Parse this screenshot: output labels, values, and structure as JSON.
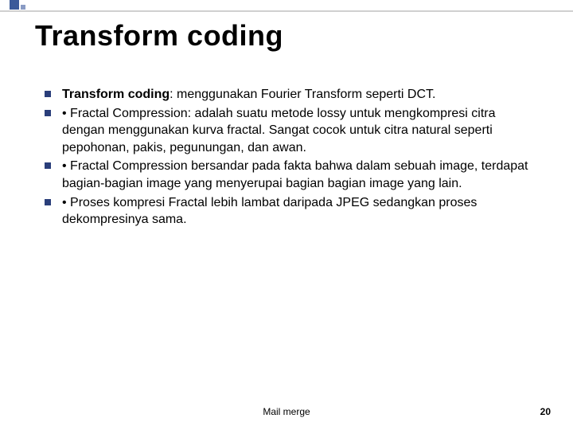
{
  "title": "Transform coding",
  "bullets": [
    {
      "prefix": "Transform coding",
      "text": ": menggunakan Fourier Transform seperti DCT."
    },
    {
      "prefix": "",
      "text": "• Fractal Compression: adalah suatu metode lossy untuk mengkompresi citra dengan menggunakan kurva fractal. Sangat cocok untuk citra natural seperti pepohonan, pakis, pegunungan, dan awan."
    },
    {
      "prefix": "",
      "text": "• Fractal Compression bersandar pada fakta bahwa dalam sebuah image, terdapat bagian-bagian image yang menyerupai bagian bagian image yang lain."
    },
    {
      "prefix": "",
      "text": "• Proses kompresi Fractal lebih lambat daripada JPEG sedangkan proses dekompresinya sama."
    }
  ],
  "footer": {
    "label": "Mail merge",
    "page": "20"
  }
}
